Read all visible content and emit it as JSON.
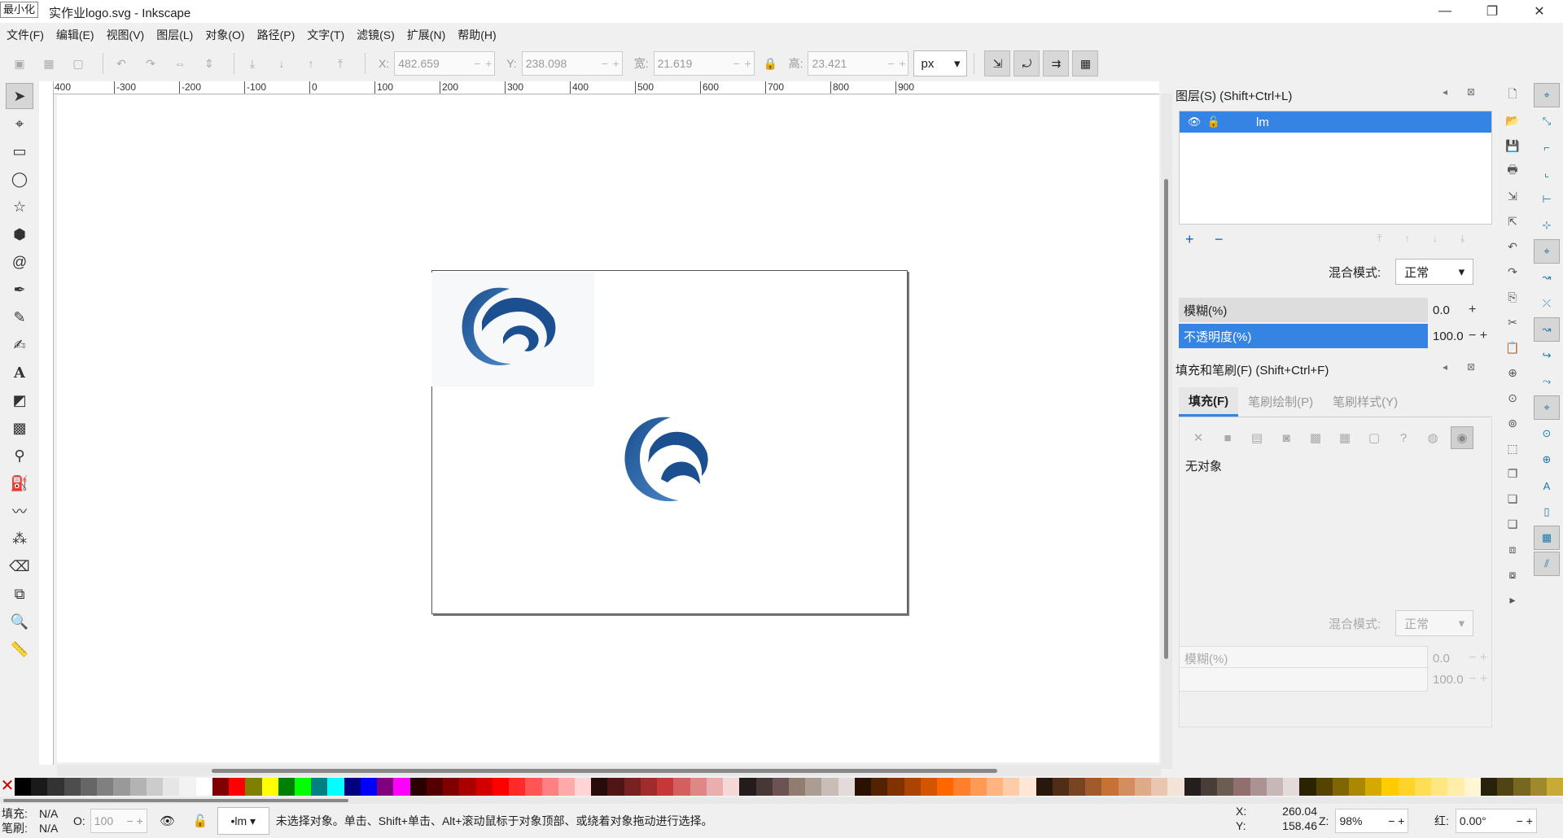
{
  "window": {
    "tooltip": "最小化",
    "title": "实作业logo.svg - Inkscape",
    "btn_min": "—",
    "btn_restore": "❐",
    "btn_close": "✕"
  },
  "menu": [
    "文件(F)",
    "编辑(E)",
    "视图(V)",
    "图层(L)",
    "对象(O)",
    "路径(P)",
    "文字(T)",
    "滤镜(S)",
    "扩展(N)",
    "帮助(H)"
  ],
  "controls": {
    "x_label": "X:",
    "x_value": "482.659",
    "y_label": "Y:",
    "y_value": "238.098",
    "w_label": "宽:",
    "w_value": "21.619",
    "h_label": "高:",
    "h_value": "23.421",
    "unit": "px"
  },
  "ruler": {
    "ticks": [
      "-400",
      "-300",
      "-200",
      "-100",
      "0",
      "100",
      "200",
      "300",
      "400",
      "500",
      "600",
      "700",
      "800",
      "900"
    ]
  },
  "layers_panel": {
    "title": "图层(S) (Shift+Ctrl+L)",
    "layer_name": "lm",
    "blend_label": "混合模式:",
    "blend_value": "正常",
    "blur_label": "模糊(%)",
    "blur_value": "0.0",
    "opacity_label": "不透明度(%)",
    "opacity_value": "100.0"
  },
  "fill_panel": {
    "title": "填充和笔刷(F) (Shift+Ctrl+F)",
    "tab_fill": "填充(F)",
    "tab_stroke_paint": "笔刷绘制(P)",
    "tab_stroke_style": "笔刷样式(Y)",
    "no_object": "无对象",
    "blend_label": "混合模式:",
    "blend_value": "正常",
    "blur_label": "模糊(%)",
    "blur_value": "0.0",
    "opacity_value": "100.0"
  },
  "status": {
    "fill_label": "填充:",
    "fill_value": "N/A",
    "stroke_label": "笔刷:",
    "stroke_value": "N/A",
    "opacity_label": "O:",
    "opacity_value": "100",
    "layer": "•lm",
    "message": "未选择对象。单击、Shift+单击、Alt+滚动鼠标于对象顶部、或绕着对象拖动进行选择。",
    "x_label": "X:",
    "x_value": "260.04",
    "y_label": "Y:",
    "y_value": "158.46",
    "zoom_label": "Z:",
    "zoom_value": "98%",
    "rot_label": "红:",
    "rot_value": "0.00°"
  },
  "colors": {
    "accent": "#3584e4",
    "logo_dark": "#1b4f8f",
    "logo_light": "#4a86c5"
  },
  "palette": [
    "#000000",
    "#1a1a1a",
    "#333333",
    "#4d4d4d",
    "#666666",
    "#808080",
    "#999999",
    "#b3b3b3",
    "#cccccc",
    "#e6e6e6",
    "#f2f2f2",
    "#ffffff",
    "#800000",
    "#ff0000",
    "#808000",
    "#ffff00",
    "#008000",
    "#00ff00",
    "#008080",
    "#00ffff",
    "#000080",
    "#0000ff",
    "#800080",
    "#ff00ff",
    "#2b0000",
    "#550000",
    "#800000",
    "#aa0000",
    "#d40000",
    "#ff0000",
    "#ff2a2a",
    "#ff5555",
    "#ff8080",
    "#ffaaaa",
    "#ffd5d5",
    "#280b0b",
    "#501616",
    "#782121",
    "#a02c2c",
    "#c83737",
    "#d35f5f",
    "#de8787",
    "#e9afaf",
    "#f4d7d7",
    "#241c1c",
    "#483737",
    "#6c5353",
    "#917c6f",
    "#ac9d93",
    "#c8beb7",
    "#e3dbdb",
    "#2b1100",
    "#552200",
    "#803300",
    "#aa4400",
    "#d45500",
    "#ff6600",
    "#ff7f2a",
    "#ff9955",
    "#ffb380",
    "#ffccaa",
    "#ffe6d5",
    "#28170b",
    "#502d16",
    "#784421",
    "#a05a2c",
    "#c87137",
    "#d38d5f",
    "#deaa87",
    "#e9c6af",
    "#f4e3d7",
    "#241f1c",
    "#483e37",
    "#6c5d53",
    "#916f6f",
    "#ac9393",
    "#c8b7b7",
    "#e3dbdb",
    "#2b2200",
    "#554400",
    "#806600",
    "#aa8800",
    "#d4aa00",
    "#ffcc00",
    "#ffd42a",
    "#ffdd55",
    "#ffe680",
    "#ffeeaa",
    "#fff6d5",
    "#28220b",
    "#504416",
    "#786721",
    "#a0892c",
    "#c8ab37"
  ],
  "canvas": {
    "logo1_bg": "#f7f8fa"
  }
}
